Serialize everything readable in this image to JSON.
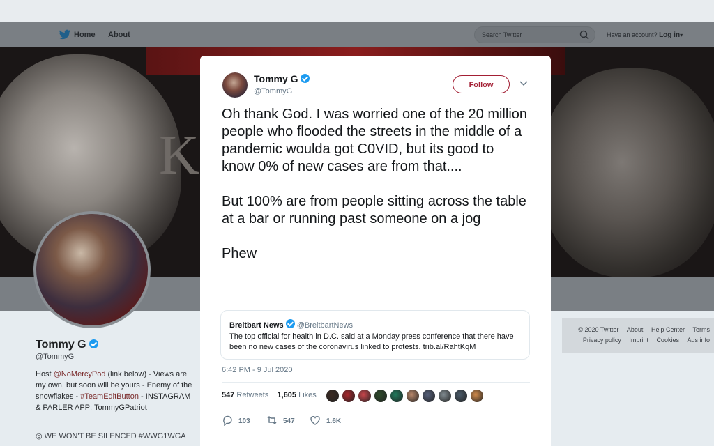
{
  "nav": {
    "home_label": "Home",
    "about_label": "About",
    "search_placeholder": "Search Twitter",
    "have_account": "Have an account?",
    "login_label": "Log in"
  },
  "banner": {
    "letter": "K"
  },
  "profile": {
    "name": "Tommy G",
    "handle": "@TommyG",
    "bio_host": "Host ",
    "bio_link1": "@NoMercyPod",
    "bio_mid": " (link below) - Views are my own, but soon will be yours - Enemy of the snowflakes - ",
    "bio_link2": "#TeamEditButton",
    "bio_end": " - INSTAGRAM & PARLER APP: TommyGPatriot",
    "location": "WE WON'T BE SILENCED #WWG1WGA"
  },
  "footer": {
    "links_row1": [
      "© 2020 Twitter",
      "About",
      "Help Center",
      "Terms"
    ],
    "links_row2": [
      "Privacy policy",
      "Imprint",
      "Cookies",
      "Ads info"
    ]
  },
  "tweet": {
    "author_name": "Tommy G",
    "author_handle": "@TommyG",
    "follow_label": "Follow",
    "text": "Oh thank God. I was worried one of the 20 million people who flooded the streets in the middle of a pandemic woulda got C0VID, but its good to know 0% of new cases are from that....\n\nBut 100% are from people sitting across the table at a bar or running past someone on a jog\n\nPhew",
    "quoted": {
      "name": "Breitbart News",
      "handle": "@BreitbartNews",
      "text": "The top official for health in D.C. said at a Monday press conference that there have been no new cases of the coronavirus linked to protests. trib.al/RahtKqM"
    },
    "timestamp": "6:42 PM - 9 Jul 2020",
    "retweets_count": "547",
    "retweets_label": "Retweets",
    "likes_count": "1,605",
    "likes_label": "Likes",
    "reply_count": "103",
    "retweet_action_count": "547",
    "like_action_count": "1.6K",
    "liker_colors": [
      "#3b2a22",
      "#a8262c",
      "#c9464c",
      "#2e4a2a",
      "#1f7a5c",
      "#b9876a",
      "#56607a",
      "#7f8a8f",
      "#4a5a68",
      "#d08a4a"
    ]
  },
  "colors": {
    "accent": "#a31f34",
    "link": "#1d9bf0"
  }
}
